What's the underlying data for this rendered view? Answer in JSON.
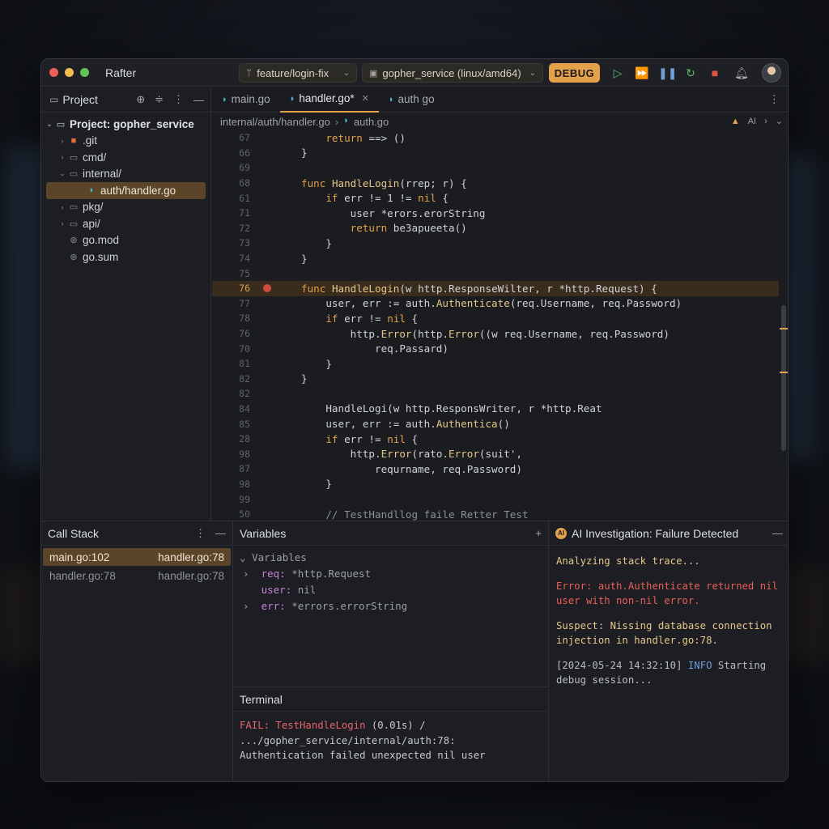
{
  "window": {
    "app_name": "Rafter"
  },
  "toolbar": {
    "branch_icon": "git-branch-icon",
    "branch": "feature/login-fix",
    "run_config": "gopher_service (linux/amd64)",
    "debug_label": "DEBUG",
    "icons": [
      "run-icon",
      "step-over-icon",
      "pause-icon",
      "restart-icon",
      "stop-icon",
      "bell-icon"
    ]
  },
  "project": {
    "title": "Project",
    "tree": [
      {
        "label": "Project: gopher_service",
        "depth": 0,
        "arrow": "⌄",
        "icon": "folder-icon",
        "root": true
      },
      {
        "label": ".git",
        "depth": 1,
        "arrow": "›",
        "icon": "git-folder-icon"
      },
      {
        "label": "cmd/",
        "depth": 1,
        "arrow": "›",
        "icon": "folder-icon"
      },
      {
        "label": "internal/",
        "depth": 1,
        "arrow": "⌄",
        "icon": "folder-icon"
      },
      {
        "label": "auth/handler.go",
        "depth": 2,
        "arrow": "",
        "icon": "go-file-icon",
        "selected": true
      },
      {
        "label": "pkg/",
        "depth": 1,
        "arrow": "›",
        "icon": "folder-icon"
      },
      {
        "label": "api/",
        "depth": 1,
        "arrow": "›",
        "icon": "folder-icon"
      },
      {
        "label": "go.mod",
        "depth": 1,
        "arrow": "",
        "icon": "go-mod-icon"
      },
      {
        "label": "go.sum",
        "depth": 1,
        "arrow": "",
        "icon": "go-mod-icon"
      }
    ]
  },
  "editor": {
    "tabs": [
      {
        "label": "main.go",
        "active": false
      },
      {
        "label": "handler.go*",
        "active": true
      },
      {
        "label": "auth go",
        "active": false
      }
    ],
    "breadcrumb": [
      "internal/auth/handler.go",
      "auth.go"
    ],
    "ai_flag": "AI",
    "lines": [
      {
        "n": "67",
        "text": "    return ==> ()"
      },
      {
        "n": "66",
        "text": "}"
      },
      {
        "n": "69",
        "text": ""
      },
      {
        "n": "68",
        "text": "func HandleLogin(rrep; r) {"
      },
      {
        "n": "61",
        "text": "    if err != 1 != nil {"
      },
      {
        "n": "71",
        "text": "        user *erors.erorString"
      },
      {
        "n": "72",
        "text": "        return be3apueeta()"
      },
      {
        "n": "73",
        "text": "    }"
      },
      {
        "n": "74",
        "text": "}"
      },
      {
        "n": "75",
        "text": ""
      },
      {
        "n": "76",
        "text": "func HandleLogin(w http.ResponseWilter, r *http.Request) {",
        "breakpoint": true
      },
      {
        "n": "77",
        "text": "    user, err := auth.Authenticate(req.Username, req.Password)"
      },
      {
        "n": "78",
        "text": "    if err != nil {"
      },
      {
        "n": "76",
        "text": "        http.Error(http.Error((w req.Username, req.Password)"
      },
      {
        "n": "70",
        "text": "            req.Passard)"
      },
      {
        "n": "81",
        "text": "    }"
      },
      {
        "n": "82",
        "text": "}"
      },
      {
        "n": "82",
        "text": ""
      },
      {
        "n": "84",
        "text": "    HandleLogi(w http.ResponsWriter, r *http.Reat"
      },
      {
        "n": "85",
        "text": "    user, err := auth.Authentica()"
      },
      {
        "n": "28",
        "text": "    if err != nil {"
      },
      {
        "n": "98",
        "text": "        http.Error(rato.Error(suit',"
      },
      {
        "n": "87",
        "text": "            requrname, req.Password)"
      },
      {
        "n": "98",
        "text": "    }"
      },
      {
        "n": "99",
        "text": ""
      },
      {
        "n": "50",
        "text": "    // TestHandllog faile Retter Test"
      }
    ]
  },
  "call_stack": {
    "title": "Call Stack",
    "frames": [
      {
        "left": "main.go:102",
        "right": "handler.go:78",
        "selected": true
      },
      {
        "left": "handler.go:78",
        "right": "handler.go:78",
        "selected": false
      }
    ]
  },
  "variables": {
    "title": "Variables",
    "group": "Variables",
    "items": [
      {
        "name": "req",
        "value": "*http.Request",
        "expandable": true
      },
      {
        "name": "user",
        "value": "nil",
        "expandable": false
      },
      {
        "name": "err",
        "value": "*errors.errorString",
        "expandable": true
      }
    ]
  },
  "terminal": {
    "title": "Terminal",
    "fail_label": "FAIL: TestHandleLogin",
    "output": " (0.01s) / .../gopher_service/internal/auth:78: Authentication failed unexpected nil user"
  },
  "ai": {
    "title": "AI Investigation: Failure Detected",
    "analyzing": "Analyzing stack trace...",
    "error": "Error: auth.Authenticate returned nil user with non-nil error.",
    "suspect": "Suspect: Nissing database connection injection in handler.go:78.",
    "log_time": "[2024-05-24 14:32:10]",
    "log_level": "INFO",
    "log_msg": "Starting debug session..."
  }
}
